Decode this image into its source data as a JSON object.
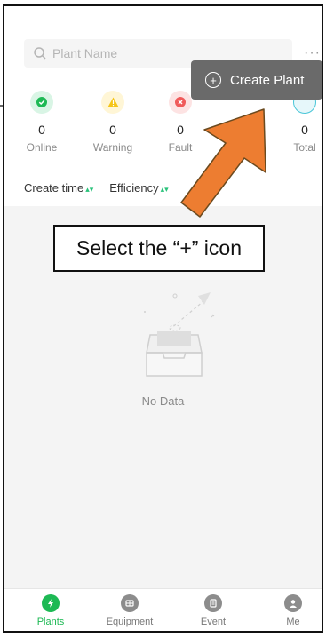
{
  "search": {
    "placeholder": "Plant Name"
  },
  "more_label": "···",
  "stats": [
    {
      "count": "0",
      "label": "Online",
      "color": "#1db954",
      "icon": "check-icon"
    },
    {
      "count": "0",
      "label": "Warning",
      "color": "#f5c518",
      "icon": "warning-icon"
    },
    {
      "count": "0",
      "label": "Fault",
      "color": "#f05a5a",
      "icon": "fault-icon"
    },
    {
      "count": "0",
      "label": "Total",
      "color": "#49c6d8",
      "icon": "total-icon"
    }
  ],
  "sort": {
    "create_time": "Create time",
    "efficiency": "Efficiency"
  },
  "empty": {
    "text": "No Data"
  },
  "popup": {
    "label": "Create Plant",
    "icon": "plus-circle-icon"
  },
  "callout": {
    "text": "Select the “+” icon"
  },
  "tabs": [
    {
      "label": "Plants",
      "icon": "bolt-icon",
      "active": true
    },
    {
      "label": "Equipment",
      "icon": "equipment-icon",
      "active": false
    },
    {
      "label": "Event",
      "icon": "event-icon",
      "active": false
    },
    {
      "label": "Me",
      "icon": "person-icon",
      "active": false
    }
  ],
  "colors": {
    "accent": "#1db954",
    "arrow": "#ed7d31",
    "popup_bg": "#6a6a6a"
  }
}
